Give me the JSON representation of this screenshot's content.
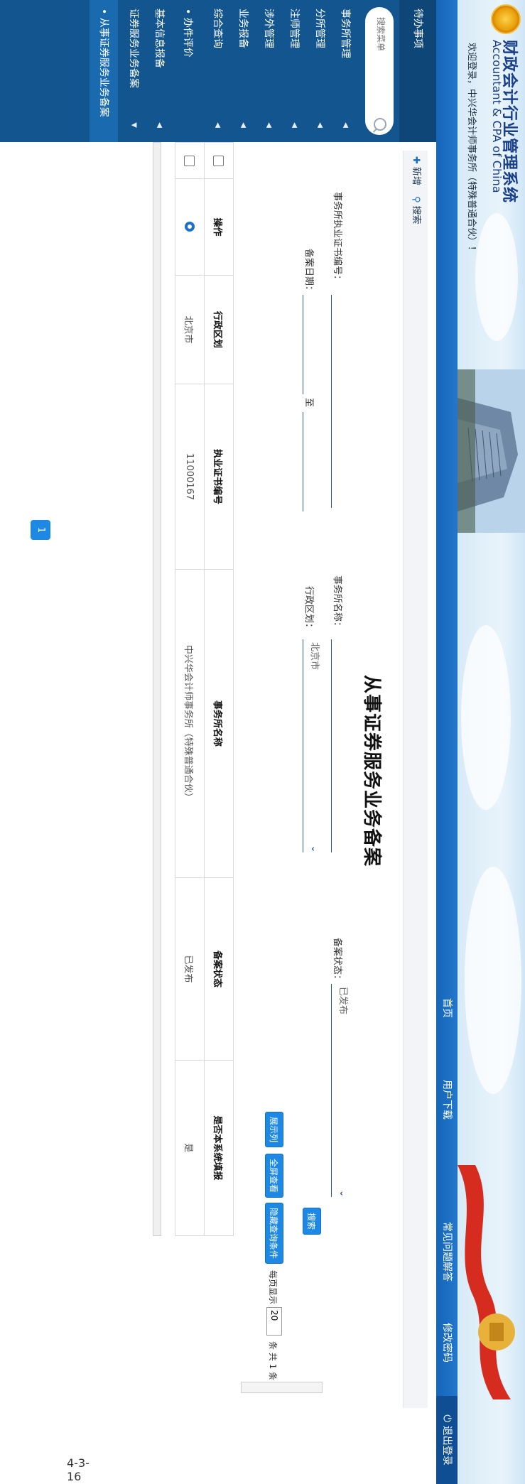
{
  "header": {
    "title_cn": "财政会计行业管理系统",
    "title_en": "Accountant & CPA of China",
    "welcome": "欢迎登录，中兴华会计师事务所（特殊普通合伙）！"
  },
  "nav": {
    "home": "首页",
    "download": "用户下载",
    "faq": "常见问题解答",
    "password": "修改密码",
    "logout": "退出登录"
  },
  "sidebar": {
    "pending": "待办事项",
    "search_placeholder": "搜索菜单",
    "items": [
      {
        "label": "事务所管理"
      },
      {
        "label": "分所管理"
      },
      {
        "label": "注师管理"
      },
      {
        "label": "涉外管理"
      },
      {
        "label": "业务报备"
      },
      {
        "label": "综合查询"
      }
    ],
    "dot_items": [
      {
        "label": "办件评价"
      }
    ],
    "items2": [
      {
        "label": "基本信息报备"
      },
      {
        "label": "证券服务业务备案"
      }
    ],
    "sub_item": "从事证券服务业务备案"
  },
  "toolbar": {
    "add": "新增",
    "search": "搜索"
  },
  "page": {
    "title": "从事证券服务业务备案"
  },
  "filters": {
    "cert_no_label": "事务所执业证书编号：",
    "firm_name_label": "事务所名称：",
    "status_label": "备案状态：",
    "status_value": "已发布",
    "date_label": "备案日期：",
    "date_sep": "至",
    "region_label": "行政区划：",
    "region_value": "北京市",
    "search_button": "搜索"
  },
  "actions": {
    "show_columns": "展示列",
    "fullscreen": "全屏查看",
    "hide_filters": "隐藏查询条件",
    "per_page_label": "每页显示",
    "per_page_value": "20",
    "total_text": "条 共 1 条"
  },
  "table": {
    "columns": [
      "操作",
      "行政区划",
      "执业证书编号",
      "事务所名称",
      "备案状态",
      "是否本系统填报"
    ],
    "rows": [
      {
        "region": "北京市",
        "cert_no": "11000167",
        "firm": "中兴华会计师事务所（特殊普通合伙）",
        "status": "已发布",
        "self_filled": "是"
      }
    ]
  },
  "pagination": {
    "current": "1"
  },
  "footer_mark": "4-3-16"
}
